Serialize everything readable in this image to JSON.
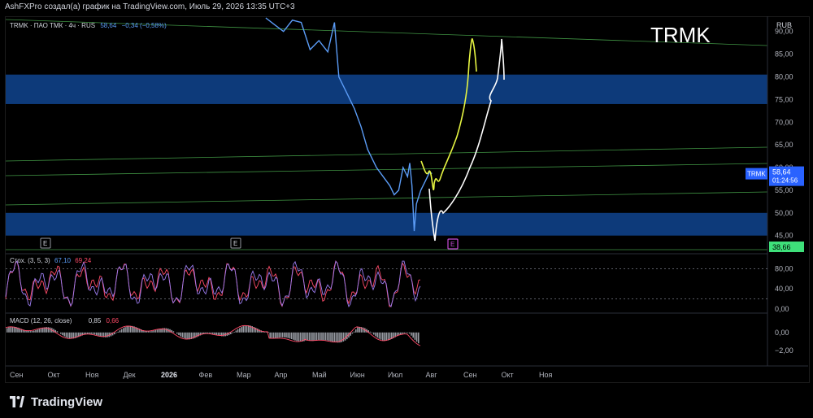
{
  "header": {
    "text": "AshFXPro создал(а) график на TradingView.com, Июль 29, 2026 13:35 UTC+3"
  },
  "symbol_line": {
    "name": "TRMK · ПАО ТМК · 4ч · RUS",
    "price": "58,64",
    "change": "−0,34 (−0,58%)"
  },
  "watermark": "TRMK",
  "currency": "RUB",
  "price_tag": {
    "symbol": "TRMK",
    "price": "58,64",
    "timer": "01:24:56"
  },
  "green_tag": "38,66",
  "stoch_legend": {
    "name": "Стох. (3, 5, 3)",
    "k": "67,10",
    "d": "69,24"
  },
  "macd_legend": {
    "name": "MACD (12, 26, close)",
    "v1": "0,85",
    "v2": "0,66"
  },
  "event_marker": "E",
  "footer": {
    "brand": "TradingView"
  },
  "colors": {
    "price_line": "#5b9cf6",
    "zone": "#0d3a7a",
    "trendline": "#4caf50",
    "yellow_path": "#e6f542",
    "white_path": "#ffffff",
    "stoch_k": "#5b9cf6",
    "stoch_d": "#f05",
    "macd_hist": "#b2b5be",
    "green_tag": "#3ee07a"
  },
  "chart_data": [
    {
      "type": "line",
      "title": "TRMK",
      "y_ticks": [
        "90,00",
        "85,00",
        "80,00",
        "75,00",
        "70,00",
        "65,00",
        "60,00",
        "55,00",
        "50,00",
        "45,00"
      ],
      "x_ticks": [
        "Сен",
        "Окт",
        "Ноя",
        "Дек",
        "2026",
        "Фев",
        "Мар",
        "Апр",
        "Май",
        "Июн",
        "Июл",
        "Авг",
        "Сен",
        "Окт",
        "Ноя"
      ],
      "ylim": [
        41,
        93
      ],
      "zones": [
        {
          "from": 74,
          "to": 80.5
        },
        {
          "from": 45,
          "to": 50
        }
      ],
      "series": [
        {
          "values": [
            [
              0.0,
              93.0
            ],
            [
              0.08,
              91.5
            ],
            [
              0.16,
              90.0
            ],
            [
              0.24,
              92.5
            ],
            [
              0.32,
              92.0
            ],
            [
              0.4,
              86.0
            ],
            [
              0.48,
              88.0
            ],
            [
              0.56,
              85.5
            ],
            [
              0.62,
              92.0
            ],
            [
              0.66,
              80.0
            ],
            [
              0.72,
              77.0
            ],
            [
              0.8,
              73.0
            ],
            [
              0.86,
              69.0
            ],
            [
              0.92,
              64.0
            ],
            [
              1.0,
              60.0
            ],
            [
              1.06,
              58.0
            ],
            [
              1.12,
              56.0
            ],
            [
              1.16,
              54.0
            ],
            [
              1.2,
              55.0
            ],
            [
              1.24,
              60.0
            ],
            [
              1.28,
              58.0
            ],
            [
              1.3,
              61.0
            ],
            [
              1.32,
              56.0
            ],
            [
              1.34,
              46.0
            ],
            [
              1.36,
              52.0
            ],
            [
              1.4,
              55.0
            ],
            [
              1.44,
              57.0
            ],
            [
              1.48,
              59.0
            ],
            [
              1.5,
              58.64
            ]
          ]
        }
      ]
    },
    {
      "type": "line",
      "title": "Стох. (3, 5, 3)",
      "y_ticks": [
        "80,00",
        "40,00",
        "0,00"
      ],
      "ylim": [
        0,
        100
      ]
    },
    {
      "type": "bar",
      "title": "MACD (12, 26, close)",
      "y_ticks": [
        "0,00",
        "−2,00"
      ],
      "ylim": [
        -3.5,
        1.5
      ]
    }
  ]
}
